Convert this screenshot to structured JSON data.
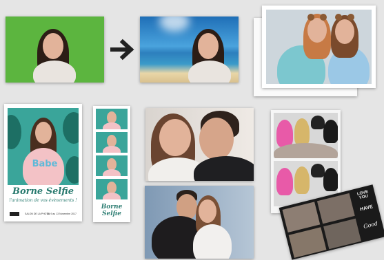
{
  "arrow_icon": "right-arrow-icon",
  "polaroid": {
    "title": "Borne Selfie",
    "tagline": "l'animation de vos évènements !",
    "footer_left": "SALON DE LA PHOTO",
    "footer_right": "Du 9 au 13 Novembre 2017",
    "shirt_text": "Babe"
  },
  "strip": {
    "caption": "Borne Selfie"
  },
  "collage": {
    "text_top": "LOVE YOU",
    "text_mid": "HAVE",
    "text_bottom": "Good"
  },
  "colors": {
    "green_screen": "#5cb53f",
    "sky": "#1d74bd",
    "teal": "#3aa59a",
    "page_bg": "#e5e5e5"
  }
}
